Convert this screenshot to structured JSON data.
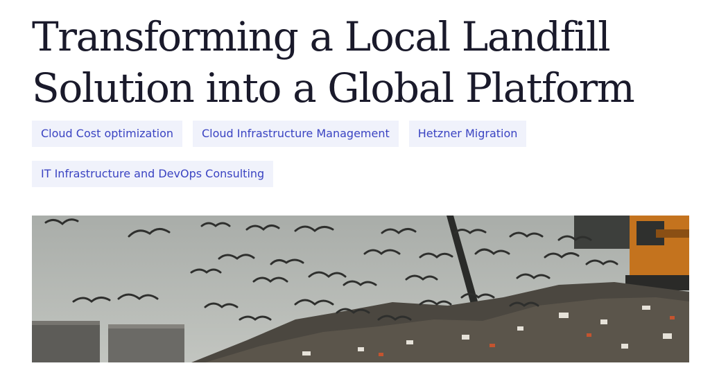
{
  "article": {
    "title_line1": "Transforming a Local Landfill",
    "title_line2": "Solution into a Global Platform"
  },
  "tags": [
    "Cloud Cost optimization",
    "Cloud Infrastructure Management",
    "Hetzner Migration",
    "IT Infrastructure and DevOps Consulting"
  ],
  "colors": {
    "title": "#1a1a2b",
    "tag_text": "#3a43c2",
    "tag_background": "#f0f2fb"
  }
}
